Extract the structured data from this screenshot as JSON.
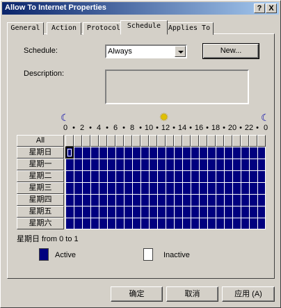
{
  "window": {
    "title": "Allow To Internet Properties",
    "help_glyph": "?",
    "close_glyph": "X"
  },
  "tabs": [
    "General",
    "Action",
    "Protocol",
    "Schedule",
    "Applies To"
  ],
  "schedule": {
    "label": "Schedule:",
    "label_underline_char": "S",
    "selected": "Always",
    "new_button": "New...",
    "description_label": "Description:",
    "description_value": ""
  },
  "hours": {
    "labels": [
      "0",
      "•",
      "2",
      "•",
      "4",
      "•",
      "6",
      "•",
      "8",
      "•",
      "10",
      "•",
      "12",
      "•",
      "14",
      "•",
      "16",
      "•",
      "18",
      "•",
      "20",
      "•",
      "22",
      "•",
      "0"
    ],
    "icons": {
      "midnight": "moon-icon",
      "noon": "sun-icon"
    }
  },
  "grid": {
    "all_label": "All",
    "days": [
      "星期日",
      "星期一",
      "星期二",
      "星期三",
      "星期四",
      "星期五",
      "星期六"
    ],
    "active_hours_per_day": 24,
    "active_color": "#00007f"
  },
  "selection_status": "星期日 from 0 to 1",
  "legend": {
    "active_label": "Active",
    "inactive_label": "Inactive",
    "active_color": "#00007f",
    "inactive_color": "#ffffff"
  },
  "buttons": {
    "ok": "确定",
    "cancel": "取消",
    "apply": "应用 (A)"
  }
}
